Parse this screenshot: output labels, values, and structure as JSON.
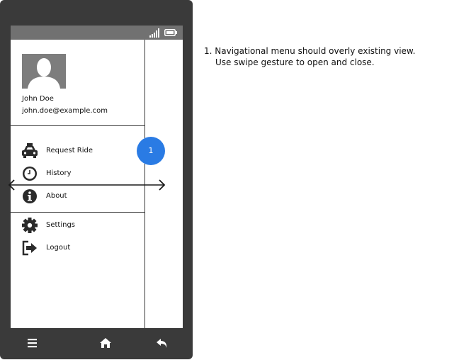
{
  "user": {
    "name": "John Doe",
    "email": "john.doe@example.com"
  },
  "menu": {
    "primary": [
      {
        "label": "Request Ride",
        "icon": "taxi-icon"
      },
      {
        "label": "History",
        "icon": "clock-icon"
      },
      {
        "label": "About",
        "icon": "info-icon"
      }
    ],
    "secondary": [
      {
        "label": "Settings",
        "icon": "gear-icon"
      },
      {
        "label": "Logout",
        "icon": "logout-icon"
      }
    ]
  },
  "annotation": {
    "badge": "1",
    "note_line1": "1. Navigational menu should overly existing view.",
    "note_line2": "Use swipe gesture to open and close."
  },
  "navbar": {
    "buttons": [
      "menu-icon",
      "home-icon",
      "back-icon"
    ]
  },
  "colors": {
    "phone_frame": "#3a3a3a",
    "status_bar": "#717171",
    "avatar_bg": "#7d7d7d",
    "badge": "#2a7be4"
  }
}
